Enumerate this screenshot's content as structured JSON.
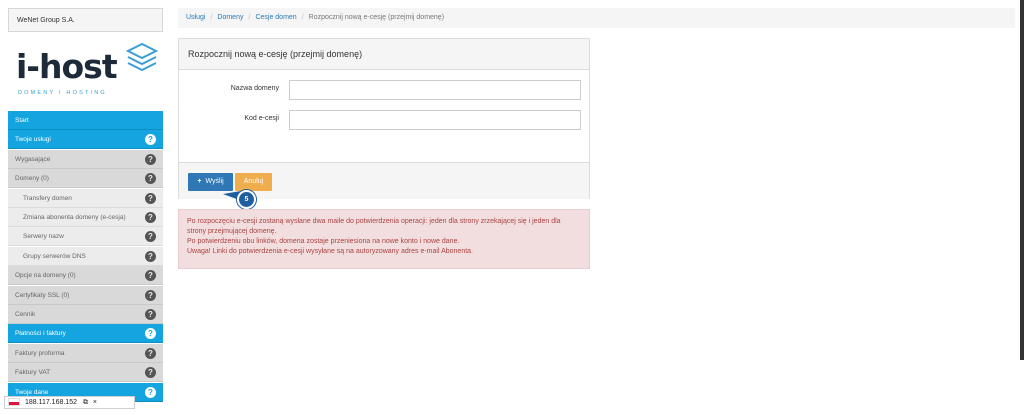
{
  "sidebar": {
    "company": "WeNet Group S.A.",
    "logo": {
      "name": "i-host",
      "tagline": "DOMENY I HOSTING"
    },
    "menu": [
      {
        "label": "Start",
        "level": "main",
        "help": false
      },
      {
        "label": "Twoje usługi",
        "level": "main",
        "help": true
      },
      {
        "label": "Wygasające",
        "level": "sub",
        "help": true
      },
      {
        "label": "Domeny (0)",
        "level": "sub",
        "help": true
      },
      {
        "label": "Transfery domen",
        "level": "sub2",
        "help": true
      },
      {
        "label": "Zmiana abonenta domeny (e-cesja)",
        "level": "sub2",
        "help": true
      },
      {
        "label": "Serwery nazw",
        "level": "sub2",
        "help": true
      },
      {
        "label": "Grupy serwerów DNS",
        "level": "sub2",
        "help": true
      },
      {
        "label": "Opcje na domeny (0)",
        "level": "sub",
        "help": true
      },
      {
        "label": "Certyfikaty SSL (0)",
        "level": "sub",
        "help": true
      },
      {
        "label": "Cennik",
        "level": "sub",
        "help": true
      },
      {
        "label": "Płatności i faktury",
        "level": "main",
        "help": true
      },
      {
        "label": "Faktury proforma",
        "level": "sub",
        "help": true
      },
      {
        "label": "Faktury VAT",
        "level": "sub",
        "help": true
      },
      {
        "label": "Twoje dane",
        "level": "main",
        "help": true
      }
    ],
    "help_glyph": "?"
  },
  "ip_bar": {
    "ip": "188.117.168.152",
    "copy_icon": "⧉",
    "close_icon": "×"
  },
  "breadcrumb": {
    "items": [
      "Usługi",
      "Domeny",
      "Cesje domen"
    ],
    "current": "Rozpocznij nową e-cesję (przejmij domenę)",
    "separator": "/"
  },
  "panel": {
    "title": "Rozpocznij nową e-cesję (przejmij domenę)",
    "fields": [
      {
        "label": "Nazwa domeny",
        "value": ""
      },
      {
        "label": "Kod e-cesji",
        "value": ""
      }
    ],
    "send_label": "Wyślij",
    "cancel_label": "Anuluj",
    "badge": "5"
  },
  "alert": {
    "lines": [
      "Po rozpoczęciu e-cesji zostaną wysłane dwa maile do potwierdzenia operacji: jeden dla strony zrzekającej się i jeden dla strony przejmującej domenę.",
      "Po potwierdzeniu obu linków, domena zostaje przeniesiona na nowe konto i nowe dane.",
      "Uwaga! Linki do potwierdzenia e-cesji wysyłane są na autoryzowany adres e-mail Abonenta."
    ]
  },
  "colors": {
    "menu_main": "#14a5e0",
    "menu_sub": "#d9d9d9",
    "btn_primary": "#2f77b5",
    "btn_warning": "#f0ad4e",
    "alert_bg": "#f2dede",
    "alert_text": "#a94442"
  }
}
